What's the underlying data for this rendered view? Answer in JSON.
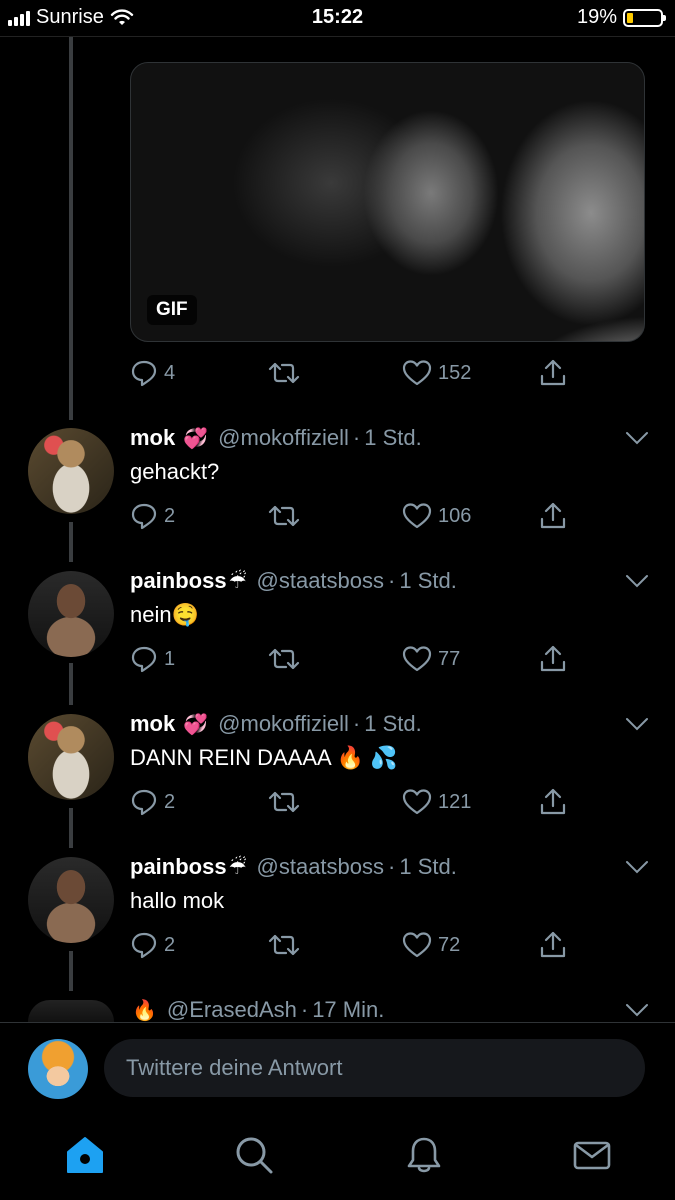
{
  "status_bar": {
    "carrier": "Sunrise",
    "time": "15:22",
    "battery_percent": "19%",
    "battery_level": 0.19
  },
  "media": {
    "badge": "GIF"
  },
  "first_actions": {
    "replies": "4",
    "retweets": "",
    "likes": "152"
  },
  "tweets": [
    {
      "name": "mok",
      "name_emoji": "💞",
      "handle": "@mokoffiziell",
      "time": "1 Std.",
      "text": "gehackt?",
      "replies": "2",
      "likes": "106"
    },
    {
      "name": "painboss",
      "name_emoji": "☔",
      "handle": "@staatsboss",
      "time": "1 Std.",
      "text": "nein🤤",
      "replies": "1",
      "likes": "77"
    },
    {
      "name": "mok",
      "name_emoji": "💞",
      "handle": "@mokoffiziell",
      "time": "1 Std.",
      "text": "DANN REIN DAAAA 🔥 💦",
      "replies": "2",
      "likes": "121"
    },
    {
      "name": "painboss",
      "name_emoji": "☔",
      "handle": "@staatsboss",
      "time": "1 Std.",
      "text": "hallo mok",
      "replies": "2",
      "likes": "72"
    },
    {
      "name": "",
      "name_emoji": "🔥",
      "handle": "@ErasedAsh",
      "time": "17 Min.",
      "text": ""
    }
  ],
  "reply_box": {
    "placeholder": "Twittere deine Antwort"
  },
  "tabs": [
    "home-icon",
    "search-icon",
    "notifications-icon",
    "messages-icon"
  ],
  "colors": {
    "accent": "#1da1f2",
    "muted": "#8899a6",
    "background": "#000000"
  }
}
